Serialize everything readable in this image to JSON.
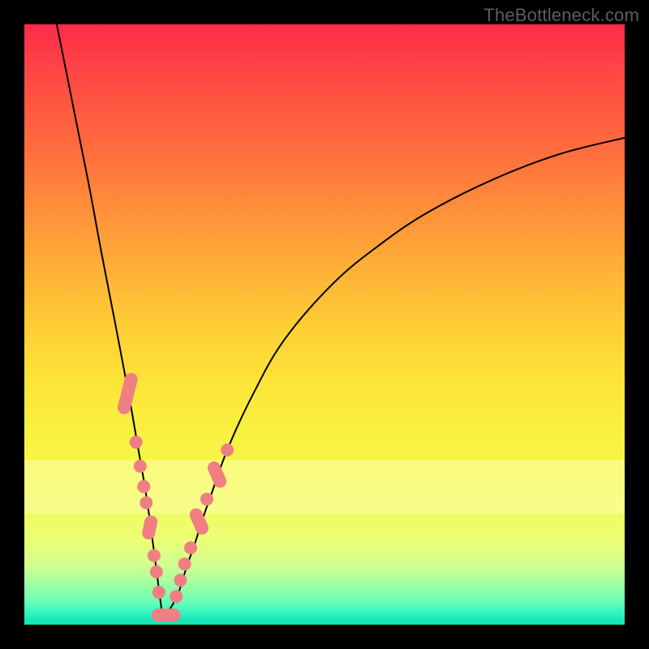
{
  "watermark": "TheBottleneck.com",
  "colors": {
    "frame": "#000000",
    "marker": "#f07f84",
    "curve": "#000000",
    "gradient_top": "#ff2a4a",
    "gradient_bottom": "#19e4b6"
  },
  "chart_data": {
    "type": "line",
    "title": "",
    "xlabel": "",
    "ylabel": "",
    "xlim": [
      0,
      100
    ],
    "ylim": [
      0,
      100
    ],
    "grid": false,
    "legend": false,
    "annotations": [
      "TheBottleneck.com"
    ],
    "highlight_band_y": [
      19,
      28
    ],
    "series": [
      {
        "name": "left-branch",
        "x": [
          5.4,
          8.1,
          10.8,
          12.8,
          14.9,
          16.2,
          17.6,
          18.9,
          20.3,
          21.6,
          22.3,
          23.0
        ],
        "y": [
          100.0,
          86.5,
          73.0,
          62.2,
          51.4,
          44.6,
          37.2,
          29.7,
          21.6,
          12.2,
          6.8,
          1.4
        ]
      },
      {
        "name": "right-branch",
        "x": [
          23.0,
          24.3,
          25.7,
          27.0,
          28.4,
          29.7,
          31.1,
          33.8,
          37.8,
          43.2,
          51.4,
          59.5,
          67.6,
          78.4,
          89.2,
          100.0
        ],
        "y": [
          1.4,
          2.7,
          5.4,
          9.5,
          13.5,
          17.6,
          21.6,
          29.1,
          37.8,
          47.3,
          56.8,
          63.5,
          68.9,
          74.3,
          78.4,
          81.1
        ]
      }
    ],
    "markers": [
      {
        "branch": "left",
        "x": 17.2,
        "y": 38.5,
        "shape": "pill-v"
      },
      {
        "branch": "left",
        "x": 18.6,
        "y": 30.4,
        "shape": "dot"
      },
      {
        "branch": "left",
        "x": 19.3,
        "y": 26.4,
        "shape": "dot"
      },
      {
        "branch": "left",
        "x": 19.9,
        "y": 23.0,
        "shape": "dot"
      },
      {
        "branch": "left",
        "x": 20.3,
        "y": 20.3,
        "shape": "dot"
      },
      {
        "branch": "left",
        "x": 20.9,
        "y": 16.2,
        "shape": "pill-v-sm"
      },
      {
        "branch": "left",
        "x": 21.6,
        "y": 11.5,
        "shape": "dot"
      },
      {
        "branch": "left",
        "x": 22.0,
        "y": 8.8,
        "shape": "dot"
      },
      {
        "branch": "left",
        "x": 22.4,
        "y": 5.4,
        "shape": "dot"
      },
      {
        "branch": "valley",
        "x": 23.6,
        "y": 1.6,
        "shape": "pill-h"
      },
      {
        "branch": "right",
        "x": 25.3,
        "y": 4.7,
        "shape": "dot"
      },
      {
        "branch": "right",
        "x": 26.0,
        "y": 7.4,
        "shape": "dot"
      },
      {
        "branch": "right",
        "x": 26.7,
        "y": 10.1,
        "shape": "dot"
      },
      {
        "branch": "right",
        "x": 27.7,
        "y": 12.8,
        "shape": "dot"
      },
      {
        "branch": "right",
        "x": 29.1,
        "y": 17.2,
        "shape": "pill-d"
      },
      {
        "branch": "right",
        "x": 30.4,
        "y": 20.9,
        "shape": "dot"
      },
      {
        "branch": "right",
        "x": 32.1,
        "y": 25.0,
        "shape": "pill-d"
      },
      {
        "branch": "right",
        "x": 33.8,
        "y": 29.1,
        "shape": "dot"
      }
    ]
  }
}
